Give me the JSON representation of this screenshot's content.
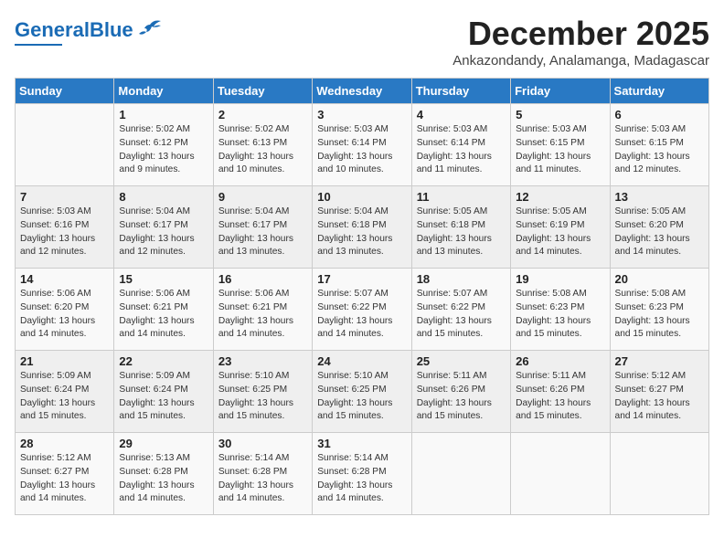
{
  "logo": {
    "text1": "General",
    "text2": "Blue"
  },
  "header": {
    "month": "December 2025",
    "location": "Ankazondandy, Analamanga, Madagascar"
  },
  "weekdays": [
    "Sunday",
    "Monday",
    "Tuesday",
    "Wednesday",
    "Thursday",
    "Friday",
    "Saturday"
  ],
  "weeks": [
    [
      {
        "day": "",
        "info": ""
      },
      {
        "day": "1",
        "info": "Sunrise: 5:02 AM\nSunset: 6:12 PM\nDaylight: 13 hours\nand 9 minutes."
      },
      {
        "day": "2",
        "info": "Sunrise: 5:02 AM\nSunset: 6:13 PM\nDaylight: 13 hours\nand 10 minutes."
      },
      {
        "day": "3",
        "info": "Sunrise: 5:03 AM\nSunset: 6:14 PM\nDaylight: 13 hours\nand 10 minutes."
      },
      {
        "day": "4",
        "info": "Sunrise: 5:03 AM\nSunset: 6:14 PM\nDaylight: 13 hours\nand 11 minutes."
      },
      {
        "day": "5",
        "info": "Sunrise: 5:03 AM\nSunset: 6:15 PM\nDaylight: 13 hours\nand 11 minutes."
      },
      {
        "day": "6",
        "info": "Sunrise: 5:03 AM\nSunset: 6:15 PM\nDaylight: 13 hours\nand 12 minutes."
      }
    ],
    [
      {
        "day": "7",
        "info": "Sunrise: 5:03 AM\nSunset: 6:16 PM\nDaylight: 13 hours\nand 12 minutes."
      },
      {
        "day": "8",
        "info": "Sunrise: 5:04 AM\nSunset: 6:17 PM\nDaylight: 13 hours\nand 12 minutes."
      },
      {
        "day": "9",
        "info": "Sunrise: 5:04 AM\nSunset: 6:17 PM\nDaylight: 13 hours\nand 13 minutes."
      },
      {
        "day": "10",
        "info": "Sunrise: 5:04 AM\nSunset: 6:18 PM\nDaylight: 13 hours\nand 13 minutes."
      },
      {
        "day": "11",
        "info": "Sunrise: 5:05 AM\nSunset: 6:18 PM\nDaylight: 13 hours\nand 13 minutes."
      },
      {
        "day": "12",
        "info": "Sunrise: 5:05 AM\nSunset: 6:19 PM\nDaylight: 13 hours\nand 14 minutes."
      },
      {
        "day": "13",
        "info": "Sunrise: 5:05 AM\nSunset: 6:20 PM\nDaylight: 13 hours\nand 14 minutes."
      }
    ],
    [
      {
        "day": "14",
        "info": "Sunrise: 5:06 AM\nSunset: 6:20 PM\nDaylight: 13 hours\nand 14 minutes."
      },
      {
        "day": "15",
        "info": "Sunrise: 5:06 AM\nSunset: 6:21 PM\nDaylight: 13 hours\nand 14 minutes."
      },
      {
        "day": "16",
        "info": "Sunrise: 5:06 AM\nSunset: 6:21 PM\nDaylight: 13 hours\nand 14 minutes."
      },
      {
        "day": "17",
        "info": "Sunrise: 5:07 AM\nSunset: 6:22 PM\nDaylight: 13 hours\nand 14 minutes."
      },
      {
        "day": "18",
        "info": "Sunrise: 5:07 AM\nSunset: 6:22 PM\nDaylight: 13 hours\nand 15 minutes."
      },
      {
        "day": "19",
        "info": "Sunrise: 5:08 AM\nSunset: 6:23 PM\nDaylight: 13 hours\nand 15 minutes."
      },
      {
        "day": "20",
        "info": "Sunrise: 5:08 AM\nSunset: 6:23 PM\nDaylight: 13 hours\nand 15 minutes."
      }
    ],
    [
      {
        "day": "21",
        "info": "Sunrise: 5:09 AM\nSunset: 6:24 PM\nDaylight: 13 hours\nand 15 minutes."
      },
      {
        "day": "22",
        "info": "Sunrise: 5:09 AM\nSunset: 6:24 PM\nDaylight: 13 hours\nand 15 minutes."
      },
      {
        "day": "23",
        "info": "Sunrise: 5:10 AM\nSunset: 6:25 PM\nDaylight: 13 hours\nand 15 minutes."
      },
      {
        "day": "24",
        "info": "Sunrise: 5:10 AM\nSunset: 6:25 PM\nDaylight: 13 hours\nand 15 minutes."
      },
      {
        "day": "25",
        "info": "Sunrise: 5:11 AM\nSunset: 6:26 PM\nDaylight: 13 hours\nand 15 minutes."
      },
      {
        "day": "26",
        "info": "Sunrise: 5:11 AM\nSunset: 6:26 PM\nDaylight: 13 hours\nand 15 minutes."
      },
      {
        "day": "27",
        "info": "Sunrise: 5:12 AM\nSunset: 6:27 PM\nDaylight: 13 hours\nand 14 minutes."
      }
    ],
    [
      {
        "day": "28",
        "info": "Sunrise: 5:12 AM\nSunset: 6:27 PM\nDaylight: 13 hours\nand 14 minutes."
      },
      {
        "day": "29",
        "info": "Sunrise: 5:13 AM\nSunset: 6:28 PM\nDaylight: 13 hours\nand 14 minutes."
      },
      {
        "day": "30",
        "info": "Sunrise: 5:14 AM\nSunset: 6:28 PM\nDaylight: 13 hours\nand 14 minutes."
      },
      {
        "day": "31",
        "info": "Sunrise: 5:14 AM\nSunset: 6:28 PM\nDaylight: 13 hours\nand 14 minutes."
      },
      {
        "day": "",
        "info": ""
      },
      {
        "day": "",
        "info": ""
      },
      {
        "day": "",
        "info": ""
      }
    ]
  ]
}
